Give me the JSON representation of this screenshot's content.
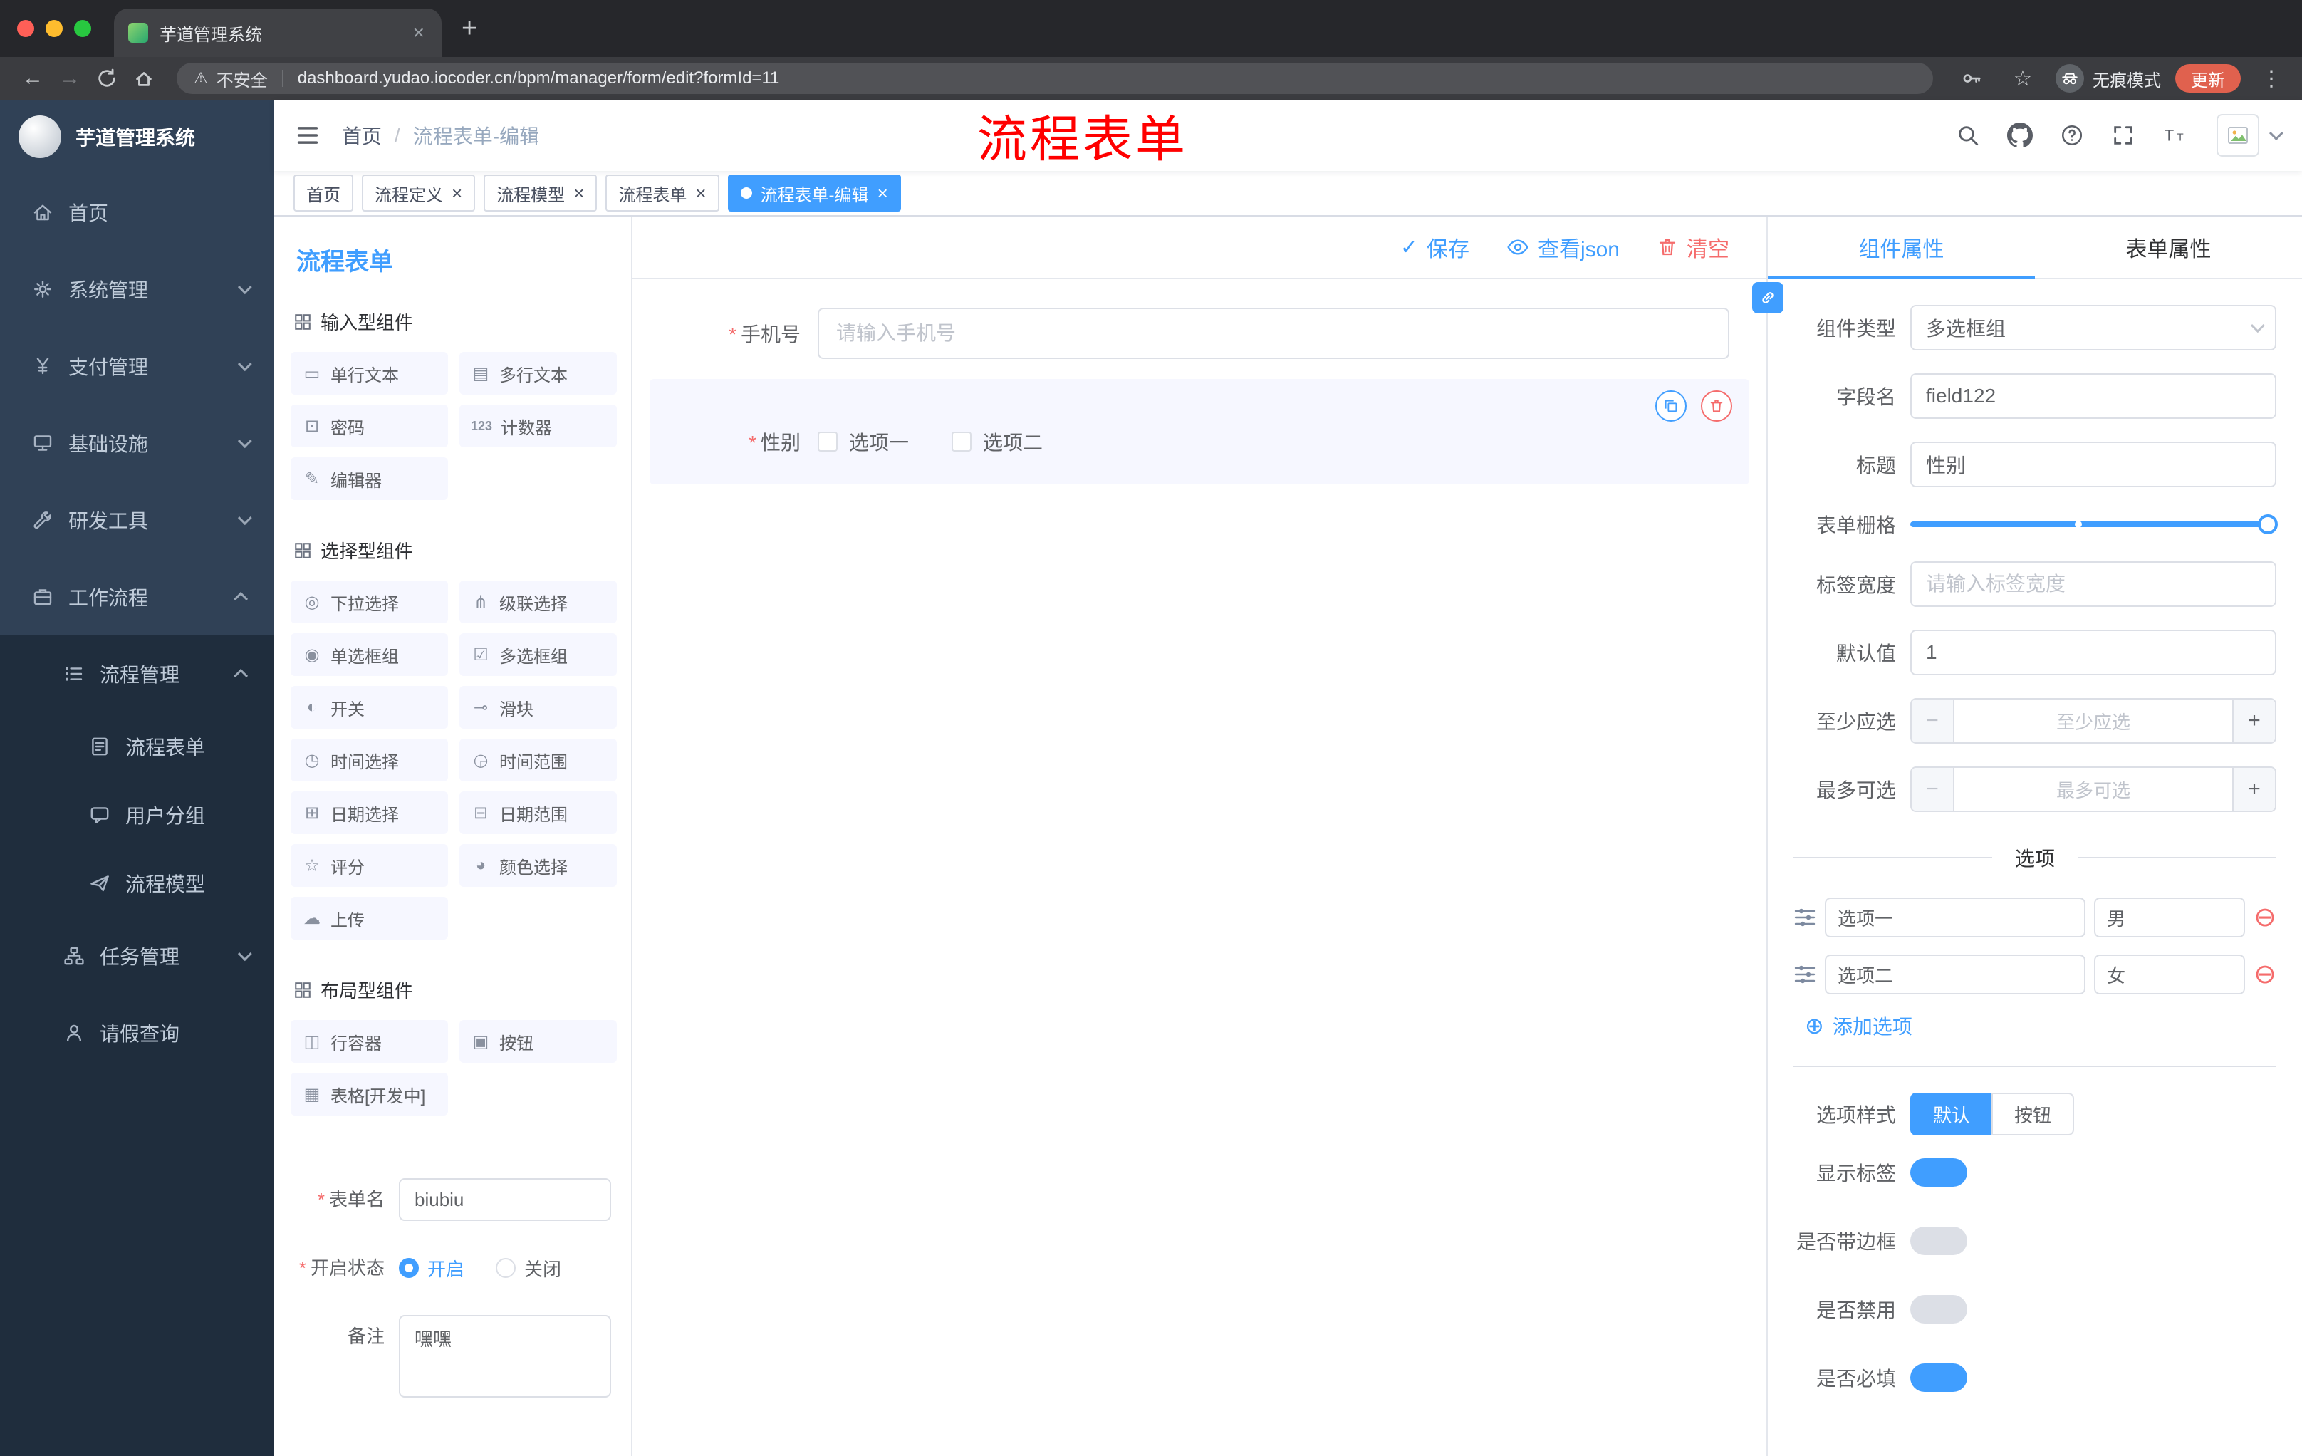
{
  "colors": {
    "primary": "#409eff",
    "danger": "#f56c6c"
  },
  "browser": {
    "tab_title": "芋道管理系统",
    "security_label": "不安全",
    "url": "dashboard.yudao.iocoder.cn/bpm/manager/form/edit?formId=11",
    "incognito_label": "无痕模式",
    "update_label": "更新"
  },
  "sidebar": {
    "logo_title": "芋道管理系统",
    "menu": [
      {
        "label": "首页"
      },
      {
        "label": "系统管理"
      },
      {
        "label": "支付管理"
      },
      {
        "label": "基础设施"
      },
      {
        "label": "研发工具"
      },
      {
        "label": "工作流程"
      },
      {
        "label": "流程管理"
      },
      {
        "label": "流程表单"
      },
      {
        "label": "用户分组"
      },
      {
        "label": "流程模型"
      },
      {
        "label": "任务管理"
      },
      {
        "label": "请假查询"
      }
    ]
  },
  "header": {
    "breadcrumb": [
      "首页",
      "流程表单-编辑"
    ],
    "annotation": "流程表单"
  },
  "tags": [
    {
      "label": "首页"
    },
    {
      "label": "流程定义"
    },
    {
      "label": "流程模型"
    },
    {
      "label": "流程表单"
    },
    {
      "label": "流程表单-编辑"
    }
  ],
  "palette": {
    "title": "流程表单",
    "groups": [
      {
        "title": "输入型组件",
        "items": [
          {
            "label": "单行文本",
            "icon": "▭"
          },
          {
            "label": "多行文本",
            "icon": "▤"
          },
          {
            "label": "密码",
            "icon": "⊡"
          },
          {
            "label": "计数器",
            "icon": "123"
          },
          {
            "label": "编辑器",
            "icon": "✎"
          }
        ]
      },
      {
        "title": "选择型组件",
        "items": [
          {
            "label": "下拉选择",
            "icon": "◎"
          },
          {
            "label": "级联选择",
            "icon": "⋔"
          },
          {
            "label": "单选框组",
            "icon": "◉"
          },
          {
            "label": "多选框组",
            "icon": "☑"
          },
          {
            "label": "开关",
            "icon": "◐"
          },
          {
            "label": "滑块",
            "icon": "⊸"
          },
          {
            "label": "时间选择",
            "icon": "◷"
          },
          {
            "label": "时间范围",
            "icon": "◶"
          },
          {
            "label": "日期选择",
            "icon": "⊞"
          },
          {
            "label": "日期范围",
            "icon": "⊟"
          },
          {
            "label": "评分",
            "icon": "☆"
          },
          {
            "label": "颜色选择",
            "icon": "◕"
          },
          {
            "label": "上传",
            "icon": "☁"
          }
        ]
      },
      {
        "title": "布局型组件",
        "items": [
          {
            "label": "行容器",
            "icon": "◫"
          },
          {
            "label": "按钮",
            "icon": "▣"
          },
          {
            "label": "表格[开发中]",
            "icon": "▦"
          }
        ]
      }
    ],
    "form": {
      "name_label": "表单名",
      "name_value": "biubiu",
      "status_label": "开启状态",
      "status_on": "开启",
      "status_off": "关闭",
      "remark_label": "备注",
      "remark_value": "嘿嘿"
    }
  },
  "canvas": {
    "toolbar": {
      "save": "保存",
      "view_json": "查看json",
      "clear": "清空"
    },
    "phone_field": {
      "label": "手机号",
      "placeholder": "请输入手机号"
    },
    "gender_field": {
      "label": "性别",
      "options": [
        "选项一",
        "选项二"
      ]
    }
  },
  "props": {
    "tabs": [
      "组件属性",
      "表单属性"
    ],
    "rows": {
      "type_label": "组件类型",
      "type_value": "多选框组",
      "field_label": "字段名",
      "field_value": "field122",
      "title_label": "标题",
      "title_value": "性别",
      "grid_label": "表单栅格",
      "label_width_label": "标签宽度",
      "label_width_placeholder": "请输入标签宽度",
      "default_label": "默认值",
      "default_value": "1",
      "min_label": "至少应选",
      "min_placeholder": "至少应选",
      "max_label": "最多可选",
      "max_placeholder": "最多可选"
    },
    "options_title": "选项",
    "options": [
      {
        "label": "选项一",
        "value": "男"
      },
      {
        "label": "选项二",
        "value": "女"
      }
    ],
    "add_option": "添加选项",
    "style_label": "选项样式",
    "style_options": [
      "默认",
      "按钮"
    ],
    "toggles": [
      {
        "label": "显示标签",
        "on": true
      },
      {
        "label": "是否带边框",
        "on": false
      },
      {
        "label": "是否禁用",
        "on": false
      },
      {
        "label": "是否必填",
        "on": true
      }
    ]
  }
}
